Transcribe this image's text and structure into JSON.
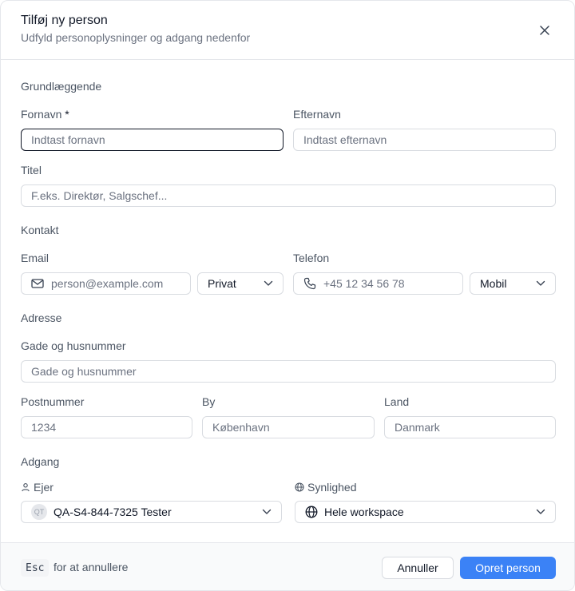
{
  "dialog": {
    "title": "Tilføj ny person",
    "subtitle": "Udfyld personoplysninger og adgang nedenfor"
  },
  "sections": {
    "basics": "Grundlæggende",
    "contact": "Kontakt",
    "address": "Adresse",
    "access": "Adgang"
  },
  "fields": {
    "first_name": {
      "label": "Fornavn",
      "required_mark": "*",
      "placeholder": "Indtast fornavn"
    },
    "last_name": {
      "label": "Efternavn",
      "placeholder": "Indtast efternavn"
    },
    "title": {
      "label": "Titel",
      "placeholder": "F.eks. Direktør, Salgschef..."
    },
    "email": {
      "label": "Email",
      "placeholder": "person@example.com",
      "type_selected": "Privat"
    },
    "phone": {
      "label": "Telefon",
      "placeholder": "+45 12 34 56 78",
      "type_selected": "Mobil"
    },
    "street": {
      "label": "Gade og husnummer",
      "placeholder": "Gade og husnummer"
    },
    "postal": {
      "label": "Postnummer",
      "placeholder": "1234"
    },
    "city": {
      "label": "By",
      "placeholder": "København"
    },
    "country": {
      "label": "Land",
      "placeholder": "Danmark"
    },
    "owner": {
      "label": "Ejer",
      "avatar_initials": "QT",
      "selected": "QA-S4-844-7325 Tester"
    },
    "visibility": {
      "label": "Synlighed",
      "selected": "Hele workspace"
    }
  },
  "footer": {
    "kbd": "Esc",
    "hint": "for at annullere",
    "cancel_label": "Annuller",
    "create_label": "Opret person"
  },
  "colors": {
    "primary": "#3b82f6",
    "border": "#d9dce1",
    "muted_text": "#6b7280",
    "footer_bg": "#f9fafb"
  },
  "icons": {
    "close": "close-icon",
    "email": "mail-icon",
    "phone": "phone-icon",
    "owner": "user-icon",
    "visibility": "globe-icon",
    "dropdown": "chevron-down-icon"
  }
}
